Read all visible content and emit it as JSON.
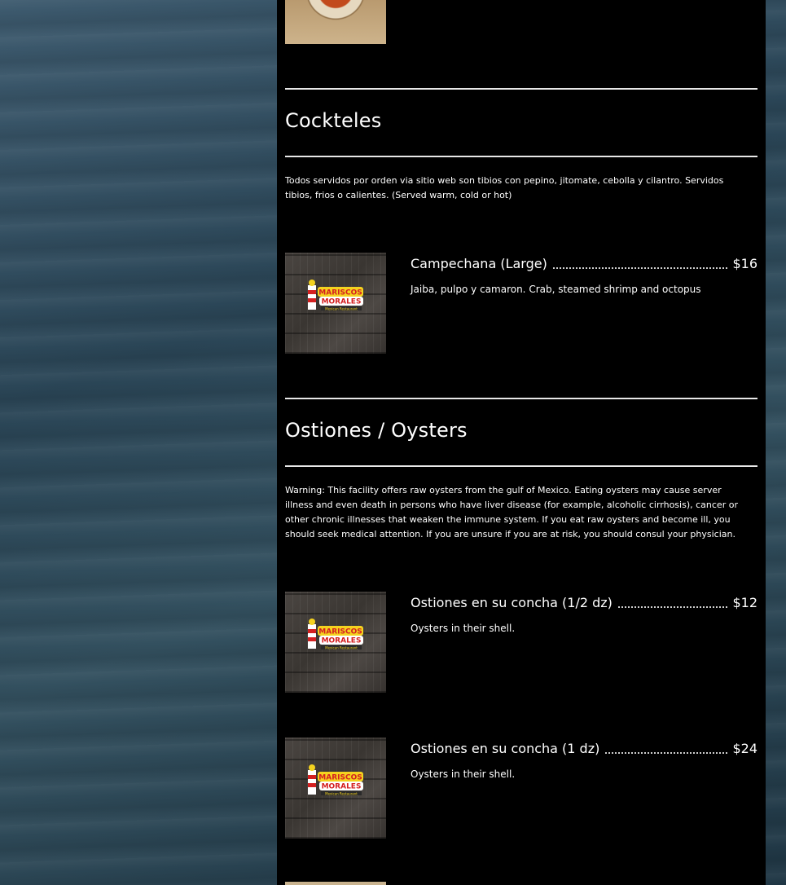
{
  "sections": [
    {
      "title": "Cockteles",
      "description": "Todos servidos por orden via sitio web son tibios con pepino, jitomate, cebolla y cilantro. Servidos tibios, frios o calientes. (Served warm, cold or hot)",
      "items": [
        {
          "name": "Campechana (Large)",
          "price": "$16",
          "description": "Jaiba, pulpo y camaron. Crab, steamed shrimp and octopus"
        }
      ]
    },
    {
      "title": "Ostiones / Oysters",
      "description": "Warning: This facility offers raw oysters from the gulf of Mexico. Eating oysters may cause server illness and even death in persons who have liver disease (for example, alcoholic cirrhosis), cancer or other chronic illnesses that weaken the immune system. If you eat raw oysters and become ill, you should seek medical attention. If you are unsure if you are at risk, you should consul your physician.",
      "items": [
        {
          "name": "Ostiones en su concha (1/2 dz)",
          "price": "$12",
          "description": "Oysters in their shell."
        },
        {
          "name": "Ostiones en su concha (1 dz)",
          "price": "$24",
          "description": "Oysters in their shell."
        }
      ]
    }
  ],
  "logo_text": {
    "line1": "MARISCOS",
    "line2": "MORALES",
    "line3": "Mexican Restaurant"
  },
  "colors": {
    "panel": "#000000",
    "text": "#ffffff",
    "divider": "#e8e8e8",
    "logo_red": "#d42020",
    "logo_yellow": "#f4d21f"
  }
}
